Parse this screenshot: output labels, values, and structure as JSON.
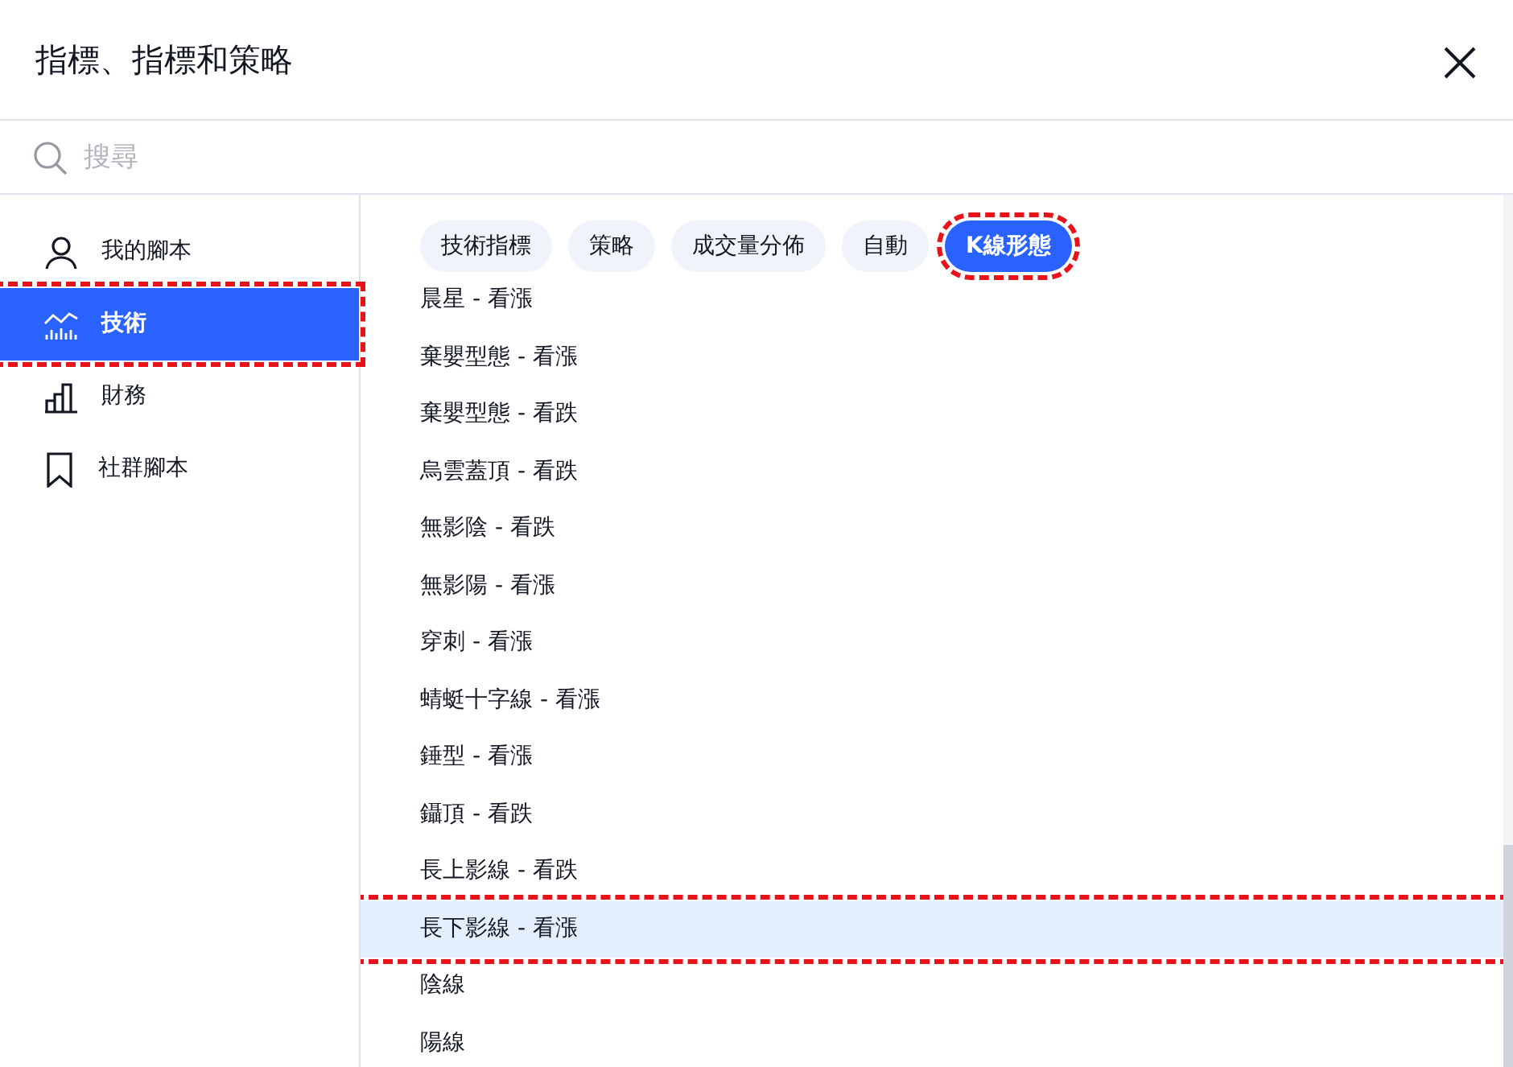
{
  "dialog": {
    "title": "指標、指標和策略"
  },
  "search": {
    "placeholder": "搜尋"
  },
  "sidebar": {
    "items": [
      {
        "label": "我的腳本",
        "selected": false,
        "marked": false
      },
      {
        "label": "技術",
        "selected": true,
        "marked": true
      },
      {
        "label": "財務",
        "selected": false,
        "marked": false
      },
      {
        "label": "社群腳本",
        "selected": false,
        "marked": false
      }
    ]
  },
  "chips": [
    {
      "label": "技術指標",
      "selected": false,
      "marked": false
    },
    {
      "label": "策略",
      "selected": false,
      "marked": false
    },
    {
      "label": "成交量分佈",
      "selected": false,
      "marked": false
    },
    {
      "label": "自動",
      "selected": false,
      "marked": false
    },
    {
      "label": "K線形態",
      "selected": true,
      "marked": true
    }
  ],
  "list": {
    "items": [
      {
        "label": "晨星 - 看漲",
        "highlighted": false,
        "marked": false
      },
      {
        "label": "棄嬰型態 - 看漲",
        "highlighted": false,
        "marked": false
      },
      {
        "label": "棄嬰型態 - 看跌",
        "highlighted": false,
        "marked": false
      },
      {
        "label": "烏雲蓋頂 - 看跌",
        "highlighted": false,
        "marked": false
      },
      {
        "label": "無影陰 - 看跌",
        "highlighted": false,
        "marked": false
      },
      {
        "label": "無影陽 - 看漲",
        "highlighted": false,
        "marked": false
      },
      {
        "label": "穿刺 - 看漲",
        "highlighted": false,
        "marked": false
      },
      {
        "label": "蜻蜓十字線 - 看漲",
        "highlighted": false,
        "marked": false
      },
      {
        "label": "錘型 - 看漲",
        "highlighted": false,
        "marked": false
      },
      {
        "label": "鑷頂 - 看跌",
        "highlighted": false,
        "marked": false
      },
      {
        "label": "長上影線 - 看跌",
        "highlighted": false,
        "marked": false
      },
      {
        "label": "長下影線 - 看漲",
        "highlighted": true,
        "marked": true
      },
      {
        "label": "陰線",
        "highlighted": false,
        "marked": false
      },
      {
        "label": "陽線",
        "highlighted": false,
        "marked": false
      }
    ]
  }
}
